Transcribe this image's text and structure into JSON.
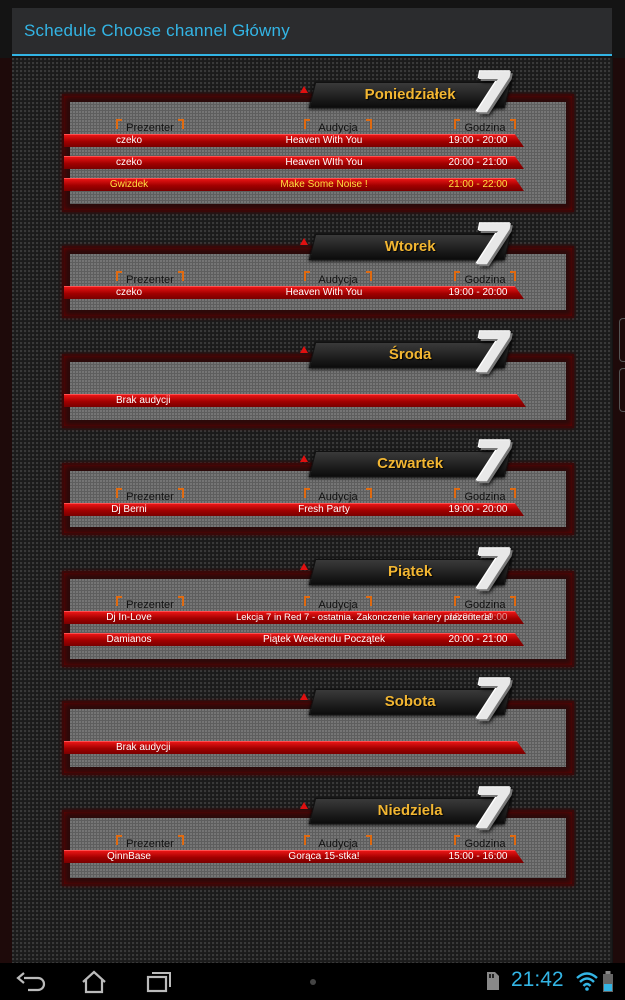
{
  "actionbar": {
    "title": "Schedule Choose channel Główny"
  },
  "columns": {
    "presenter": "Prezenter",
    "show": "Audycja",
    "hour": "Godzina"
  },
  "days": [
    {
      "name": "Poniedziałek",
      "rows": [
        {
          "presenter": "czeko",
          "show": "Heaven With You",
          "hours": "19:00 - 20:00",
          "highlight": false
        },
        {
          "presenter": "czeko",
          "show": "Heaven WIth You",
          "hours": "20:00 - 21:00",
          "highlight": false
        },
        {
          "presenter": "Gwizdek",
          "show": "Make Some Noise !",
          "hours": "21:00 - 22:00",
          "highlight": true
        }
      ]
    },
    {
      "name": "Wtorek",
      "rows": [
        {
          "presenter": "czeko",
          "show": "Heaven With You",
          "hours": "19:00 - 20:00",
          "highlight": false
        }
      ]
    },
    {
      "name": "Środa",
      "empty": "Brak audycji",
      "rows": []
    },
    {
      "name": "Czwartek",
      "rows": [
        {
          "presenter": "Dj Berni",
          "show": "Fresh Party",
          "hours": "19:00 - 20:00",
          "highlight": false
        }
      ]
    },
    {
      "name": "Piątek",
      "rows": [
        {
          "presenter": "Dj In-Love",
          "show": "Lekcja 7 in Red 7 - ostatnia. Zakonczenie kariery prezentera!",
          "hours": "18:00 - 19:00",
          "highlight": false
        },
        {
          "presenter": "Damianos",
          "show": "Piątek Weekendu Początek",
          "hours": "20:00 - 21:00",
          "highlight": false
        }
      ]
    },
    {
      "name": "Sobota",
      "empty": "Brak audycji",
      "rows": []
    },
    {
      "name": "Niedziela",
      "rows": [
        {
          "presenter": "QinnBase",
          "show": "Gorąca 15-stka!",
          "hours": "15:00 - 16:00",
          "highlight": false
        }
      ]
    }
  ],
  "badge_number": "7",
  "statusbar": {
    "clock": "21:42"
  },
  "colors": {
    "accent": "#33b5e5",
    "day_title": "#f2b632",
    "row_red": "#d00000",
    "highlight_text": "#ffe040"
  }
}
